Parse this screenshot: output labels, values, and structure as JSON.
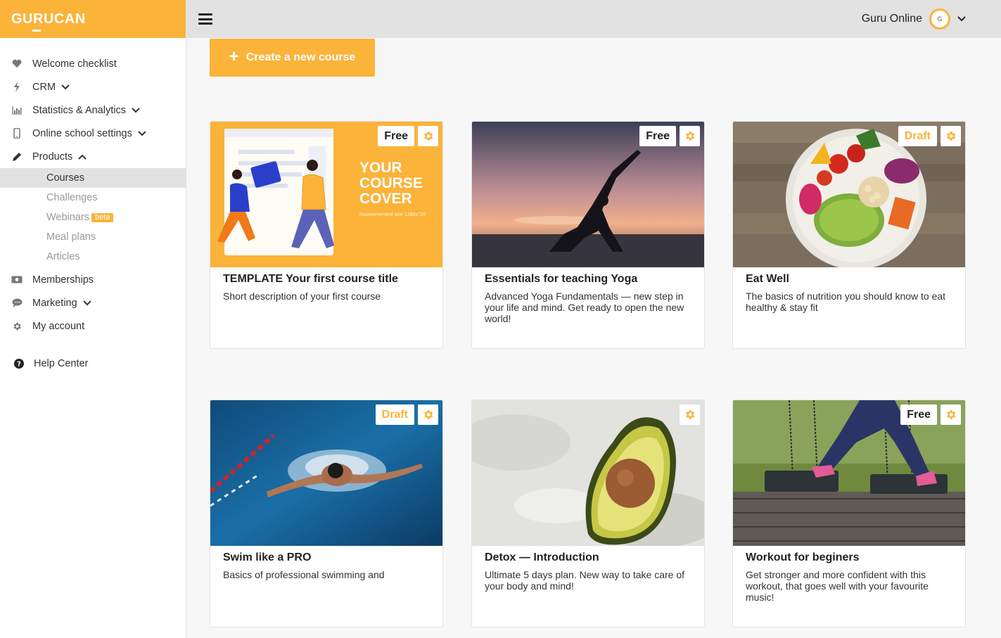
{
  "brand": {
    "logo_text": "GURUCAN",
    "accent": "#fbb33a"
  },
  "sidebar": {
    "items": [
      {
        "label": "Welcome checklist",
        "icon": "heart-icon"
      },
      {
        "label": "CRM",
        "icon": "bolt-icon"
      },
      {
        "label": "Statistics & Analytics",
        "icon": "bar-chart-icon"
      },
      {
        "label": "Online school settings",
        "icon": "phone-icon"
      },
      {
        "label": "Products",
        "icon": "pencil-icon"
      }
    ],
    "products_sub": [
      {
        "label": "Courses"
      },
      {
        "label": "Challenges"
      },
      {
        "label": "Webinars",
        "badge": "beta"
      },
      {
        "label": "Meal plans"
      },
      {
        "label": "Articles"
      }
    ],
    "items_after": [
      {
        "label": "Memberships",
        "icon": "money-icon"
      },
      {
        "label": "Marketing",
        "icon": "chat-icon"
      },
      {
        "label": "My account",
        "icon": "gear-icon"
      }
    ],
    "help": {
      "label": "Help Center",
      "icon": "question-circle-icon"
    }
  },
  "topbar": {
    "user_name": "Guru Online",
    "avatar_initial": "G"
  },
  "main": {
    "create_label": "Create a new course",
    "courses": [
      {
        "title": "TEMPLATE Your first course title",
        "description": "Short description of your first course",
        "status": "Free",
        "cover": {
          "line1": "YOUR",
          "line2": "COURSE",
          "line3": "COVER",
          "note": "Recommended size 1280x720"
        }
      },
      {
        "title": "Essentials for teaching Yoga",
        "description": "Advanced Yoga Fundamentals — new step in your life and mind. Get ready to open the new world!",
        "status": "Free"
      },
      {
        "title": "Eat Well",
        "description": "The basics of nutrition you should know to eat healthy & stay fit",
        "status": "Draft"
      },
      {
        "title": "Swim like a PRO",
        "description": "Basics of professional swimming and",
        "status": "Draft"
      },
      {
        "title": "Detox — Introduction",
        "description": "Ultimate 5 days plan. New way to take care of your body and mind!",
        "status": ""
      },
      {
        "title": "Workout for beginers",
        "description": "Get stronger and more confident with this workout, that goes well with your favourite music!",
        "status": "Free"
      }
    ]
  }
}
